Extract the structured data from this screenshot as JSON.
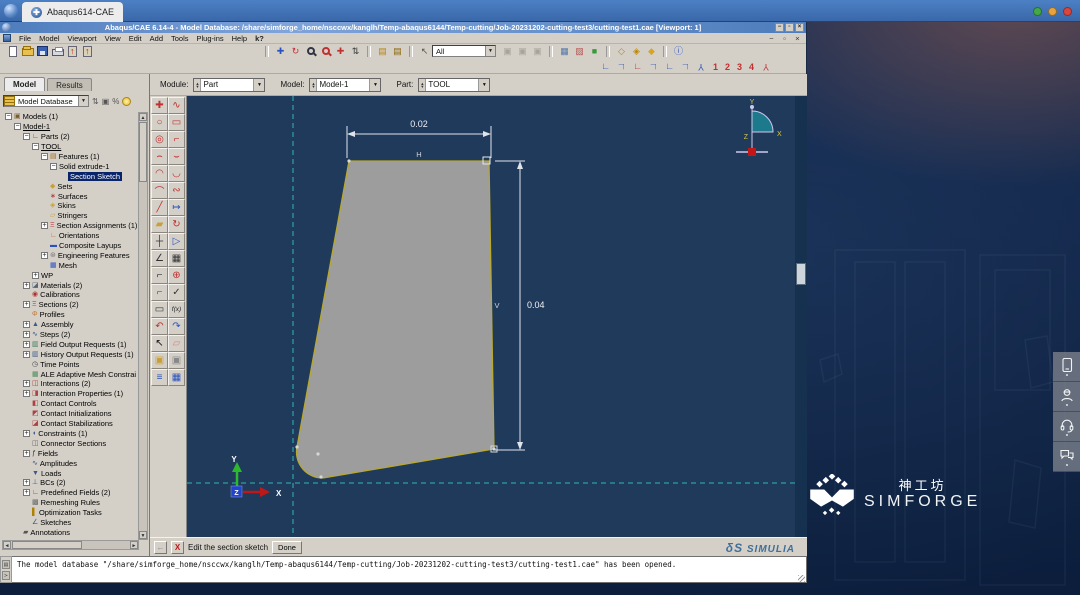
{
  "topbar": {
    "tab_title": "Abaqus614-CAE"
  },
  "window": {
    "title": "Abaqus/CAE 6.14-4 - Model Database: /share/simforge_home/nsccwx/kanglh/Temp-abaqus6144/Temp-cutting/Job-20231202-cutting-test3/cutting-test1.cae [Viewport: 1]",
    "menus": [
      "File",
      "Model",
      "Viewport",
      "View",
      "Edit",
      "Add",
      "Tools",
      "Plug-ins",
      "Help"
    ],
    "context_help": "k?",
    "mdi_controls": [
      "−",
      "▫",
      "×"
    ],
    "title_buttons": [
      "−",
      "▫",
      "×"
    ]
  },
  "toolbar": {
    "file_tools": [
      {
        "n": "new-file-button",
        "cls": "fi-new"
      },
      {
        "n": "open-file-button",
        "cls": "fi-open"
      },
      {
        "n": "save-button",
        "cls": "fi-save"
      },
      {
        "n": "print-button",
        "cls": "fi-print"
      },
      {
        "n": "mount-database-button",
        "cls": "fi-mount"
      },
      {
        "n": "attach-database-button",
        "cls": "fi-mount"
      }
    ],
    "view_tools": [
      {
        "n": "pan-view-button",
        "g": "✚",
        "c": "#2a52be"
      },
      {
        "n": "rotate-view-button",
        "g": "↻",
        "c": "#c03030"
      },
      {
        "n": "magnify-view-button",
        "cls": "fi-mag"
      },
      {
        "n": "box-zoom-button",
        "cls": "fi-mag fi-mag-red"
      },
      {
        "n": "auto-fit-view-button",
        "g": "✚",
        "c": "#c03030"
      },
      {
        "n": "cycle-views-button",
        "g": "⇅",
        "c": "#333333"
      }
    ],
    "bench_tools": [
      {
        "n": "render-beam-profiles-button",
        "g": "▤",
        "c": "#b8860b"
      },
      {
        "n": "render-shell-thickness-button",
        "g": "▤",
        "c": "#8a6508"
      }
    ],
    "selector_arrow": {
      "n": "selection-arrow-button",
      "g": "↖",
      "c": "#555555"
    },
    "selector_combo_value": "All",
    "disabled_tools": [
      {
        "n": "toolbar-disabled-button-1",
        "g": "▣"
      },
      {
        "n": "toolbar-disabled-button-2",
        "g": "▣"
      },
      {
        "n": "toolbar-disabled-button-3",
        "g": "▣"
      }
    ],
    "render_tools": [
      {
        "n": "wireframe-render-button",
        "g": "▦",
        "c": "#5577aa"
      },
      {
        "n": "hidden-line-render-button",
        "g": "▨",
        "c": "#c05050"
      },
      {
        "n": "shaded-render-button",
        "g": "■",
        "c": "#3a9a3a"
      }
    ],
    "perspective_tools": [
      {
        "n": "cube-view-button-1",
        "g": "◇",
        "c": "#b8860b"
      },
      {
        "n": "cube-view-button-2",
        "g": "◈",
        "c": "#b8860b"
      },
      {
        "n": "cube-view-button-3",
        "g": "◆",
        "c": "#d9a520"
      }
    ],
    "info_tool": {
      "n": "query-info-button",
      "g": "ⓘ",
      "c": "#2a52be"
    },
    "view_buttons": [
      {
        "n": "view-front-button",
        "g": "∟",
        "c": "#2a52be"
      },
      {
        "n": "view-back-button",
        "g": "∟",
        "c": "#2a52be",
        "flip": true
      },
      {
        "n": "view-top-button",
        "g": "∟",
        "c": "#c03030"
      },
      {
        "n": "view-bottom-button",
        "g": "∟",
        "c": "#2a52be",
        "flip": true
      },
      {
        "n": "view-left-button",
        "g": "∟",
        "c": "#2a52be"
      },
      {
        "n": "view-right-button",
        "g": "∟",
        "c": "#2a52be",
        "flip": true
      },
      {
        "n": "iso-view-button",
        "g": "Y",
        "c": "#2a52be",
        "flip": true
      }
    ],
    "view_numbers": [
      "1",
      "2",
      "3",
      "4"
    ],
    "custom_views_button": {
      "n": "custom-views-button",
      "g": "Y",
      "c": "#c03030",
      "flip": true
    }
  },
  "module_bar": {
    "module_label": "Module:",
    "module_value": "Part",
    "model_label": "Model:",
    "model_value": "Model-1",
    "part_label": "Part:",
    "part_value": "TOOL"
  },
  "left_panel": {
    "tabs": [
      {
        "label": "Model",
        "active": true
      },
      {
        "label": "Results",
        "active": false
      }
    ],
    "combo_value": "Model Database",
    "tree": [
      {
        "l": "Models (1)",
        "i": 0,
        "e": "-",
        "g": "▣",
        "c": "#7a5c2e"
      },
      {
        "l": "Model-1",
        "i": 1,
        "e": "-",
        "u": true
      },
      {
        "l": "Parts (2)",
        "i": 2,
        "e": "-",
        "g": "∟",
        "c": "#2a52be"
      },
      {
        "l": "TOOL",
        "i": 3,
        "e": "-",
        "u": true
      },
      {
        "l": "Features (1)",
        "i": 4,
        "e": "-",
        "g": "▤",
        "c": "#a86820"
      },
      {
        "l": "Solid extrude-1",
        "i": 5,
        "e": "-"
      },
      {
        "l": "Section Sketch",
        "i": 6,
        "s": true
      },
      {
        "l": "Sets",
        "i": 4,
        "g": "◆",
        "c": "#c8a03a"
      },
      {
        "l": "Surfaces",
        "i": 4,
        "g": "∗",
        "c": "#b03030"
      },
      {
        "l": "Skins",
        "i": 4,
        "g": "◈",
        "c": "#c8a03a"
      },
      {
        "l": "Stringers",
        "i": 4,
        "g": "▱",
        "c": "#c8a03a"
      },
      {
        "l": "Section Assignments (1)",
        "i": 4,
        "e": "+",
        "g": "Ξ",
        "c": "#c04040"
      },
      {
        "l": "Orientations",
        "i": 4,
        "g": "∟",
        "c": "#c87830"
      },
      {
        "l": "Composite Layups",
        "i": 4,
        "g": "▬",
        "c": "#2a52be"
      },
      {
        "l": "Engineering Features",
        "i": 4,
        "e": "+",
        "g": "⊛",
        "c": "#777777"
      },
      {
        "l": "Mesh",
        "i": 4,
        "g": "▦",
        "c": "#2a52be"
      },
      {
        "l": "WP",
        "i": 3,
        "e": "+"
      },
      {
        "l": "Materials (2)",
        "i": 2,
        "e": "+",
        "g": "◪",
        "c": "#556677"
      },
      {
        "l": "Calibrations",
        "i": 2,
        "g": "◉",
        "c": "#b03030"
      },
      {
        "l": "Sections (2)",
        "i": 2,
        "e": "+",
        "g": "Ξ",
        "c": "#c04040"
      },
      {
        "l": "Profiles",
        "i": 2,
        "g": "Φ",
        "c": "#c87830"
      },
      {
        "l": "Assembly",
        "i": 2,
        "e": "+",
        "g": "▲",
        "c": "#3a5a8a"
      },
      {
        "l": "Steps (2)",
        "i": 2,
        "e": "+",
        "g": "∿",
        "c": "#3a5a8a"
      },
      {
        "l": "Field Output Requests (1)",
        "i": 2,
        "e": "+",
        "g": "▥",
        "c": "#3a7a5a"
      },
      {
        "l": "History Output Requests (1)",
        "i": 2,
        "e": "+",
        "g": "▥",
        "c": "#3a5a8a"
      },
      {
        "l": "Time Points",
        "i": 2,
        "g": "◷",
        "c": "#444444"
      },
      {
        "l": "ALE Adaptive Mesh Constrai",
        "i": 2,
        "g": "▦",
        "c": "#4a8a5a"
      },
      {
        "l": "Interactions (2)",
        "i": 2,
        "e": "+",
        "g": "◫",
        "c": "#b04040"
      },
      {
        "l": "Interaction Properties (1)",
        "i": 2,
        "e": "+",
        "g": "◨",
        "c": "#b04040"
      },
      {
        "l": "Contact Controls",
        "i": 2,
        "g": "◧",
        "c": "#b04040"
      },
      {
        "l": "Contact Initializations",
        "i": 2,
        "g": "◩",
        "c": "#b04040"
      },
      {
        "l": "Contact Stabilizations",
        "i": 2,
        "g": "◪",
        "c": "#b04040"
      },
      {
        "l": "Constraints (1)",
        "i": 2,
        "e": "+",
        "g": "◖",
        "c": "#3a5a8a"
      },
      {
        "l": "Connector Sections",
        "i": 2,
        "g": "◫",
        "c": "#666666"
      },
      {
        "l": "Fields",
        "i": 2,
        "e": "+",
        "g": "ƒ",
        "c": "#333333"
      },
      {
        "l": "Amplitudes",
        "i": 2,
        "g": "∿",
        "c": "#3a5a8a"
      },
      {
        "l": "Loads",
        "i": 2,
        "g": "▼",
        "c": "#3a5a8a"
      },
      {
        "l": "BCs (2)",
        "i": 2,
        "e": "+",
        "g": "⊥",
        "c": "#3a5a8a"
      },
      {
        "l": "Predefined Fields (2)",
        "i": 2,
        "e": "+",
        "g": "∟",
        "c": "#3a5a8a"
      },
      {
        "l": "Remeshing Rules",
        "i": 2,
        "g": "▩",
        "c": "#666666"
      },
      {
        "l": "Optimization Tasks",
        "i": 2,
        "g": "▌",
        "c": "#b08000"
      },
      {
        "l": "Sketches",
        "i": 2,
        "g": "∠",
        "c": "#3a5a8a"
      },
      {
        "l": "Annotations",
        "i": 1,
        "g": "▰",
        "c": "#555555"
      }
    ]
  },
  "toolbox": [
    {
      "n": "create-point-tool",
      "g": "✚",
      "c": "#c03030"
    },
    {
      "n": "spline-tool",
      "g": "∿",
      "c": "#c03030"
    },
    {
      "n": "circle-tool",
      "g": "○",
      "c": "#c03030"
    },
    {
      "n": "rectangle-tool",
      "g": "▭",
      "c": "#c03030"
    },
    {
      "n": "ellipse-tool",
      "g": "◎",
      "c": "#c03030"
    },
    {
      "n": "fillet-corner-tool",
      "g": "⌐",
      "c": "#c03030"
    },
    {
      "n": "arc-center-ends-tool",
      "g": "⌢",
      "c": "#c03030"
    },
    {
      "n": "arc-thru-points-tool",
      "g": "⌣",
      "c": "#c03030"
    },
    {
      "n": "arc-tangent-tool",
      "g": "◠",
      "c": "#c03030"
    },
    {
      "n": "arc-3point-tool",
      "g": "◡",
      "c": "#c03030"
    },
    {
      "n": "round-tool",
      "g": "⌒",
      "c": "#c03030"
    },
    {
      "n": "curve-tool",
      "g": "∾",
      "c": "#c03030"
    },
    {
      "n": "line-tool",
      "g": "╱",
      "c": "#c03030"
    },
    {
      "n": "dimension-tool",
      "g": "↦",
      "c": "#2a52be"
    },
    {
      "n": "auto-trim-tool",
      "g": "▰",
      "c": "#c8a03a"
    },
    {
      "n": "flip-tool",
      "g": "↻",
      "c": "#c03030"
    },
    {
      "n": "construction-line-tool",
      "g": "┼",
      "c": "#333333"
    },
    {
      "n": "project-edges-tool",
      "g": "▷",
      "c": "#2a52be"
    },
    {
      "n": "angle-dimension-tool",
      "g": "∠",
      "c": "#333333"
    },
    {
      "n": "linear-pattern-tool",
      "g": "▦",
      "c": "#333333"
    },
    {
      "n": "offset-curves-tool",
      "g": "⌐",
      "c": "#333333"
    },
    {
      "n": "add-constraint-tool",
      "g": "⊕",
      "c": "#c03030"
    },
    {
      "n": "trim-extend-tool",
      "g": "⌐",
      "c": "#c03030"
    },
    {
      "n": "verify-tool",
      "g": "✓",
      "c": "#333333"
    },
    {
      "n": "edit-dimension-tool",
      "g": "▭",
      "c": "#333333"
    },
    {
      "n": "parameter-equation-tool",
      "t": "f(x)"
    },
    {
      "n": "undo-button",
      "g": "↶",
      "c": "#c03030"
    },
    {
      "n": "redo-button",
      "g": "↷",
      "c": "#2a52be"
    },
    {
      "n": "select-tool",
      "g": "↖",
      "c": "#111111"
    },
    {
      "n": "delete-tool",
      "g": "▱",
      "c": "#d08888"
    },
    {
      "n": "save-sketch-tool",
      "g": "▣",
      "c": "#c8a03a"
    },
    {
      "n": "load-sketch-tool",
      "g": "▣",
      "c": "#888888"
    },
    {
      "n": "sketcher-options-tool",
      "g": "≡",
      "c": "#2a52be"
    },
    {
      "n": "sketcher-grid-tool",
      "g": "▦",
      "c": "#2a52be"
    }
  ],
  "viewport": {
    "dim_width_value": "0.02",
    "dim_width_label": "H",
    "dim_height_value": "0.04",
    "dim_height_label": "V",
    "triad_x": "X",
    "triad_y": "Y",
    "triad_z": "Z",
    "compass_x": "X",
    "compass_y": "Y",
    "compass_z": "Z"
  },
  "prompt": {
    "text": "Edit the section sketch",
    "done_label": "Done"
  },
  "brand": {
    "ds_mark": "δS",
    "simulia": "SIMULIA"
  },
  "message": "The model database \"/share/simforge_home/nsccwx/kanglh/Temp-abaqus6144/Temp-cutting/Job-20231202-cutting-test3/cutting-test1.cae\" has been opened.",
  "desktop": {
    "logo_cn": "神工坊",
    "logo_en": "SIMFORGE",
    "side_icons": [
      "tablet-icon",
      "avatar-icon",
      "headset-icon",
      "chat-icon"
    ]
  },
  "colors": {
    "canvas": "#203a5c",
    "construction_line": "#2cc8b8",
    "sketch_edge": "#b9a830",
    "sketch_fill": "#9d9d9d",
    "selection": "#0a246a",
    "titlebar": "#6a93cc",
    "desktop": "#122647"
  }
}
